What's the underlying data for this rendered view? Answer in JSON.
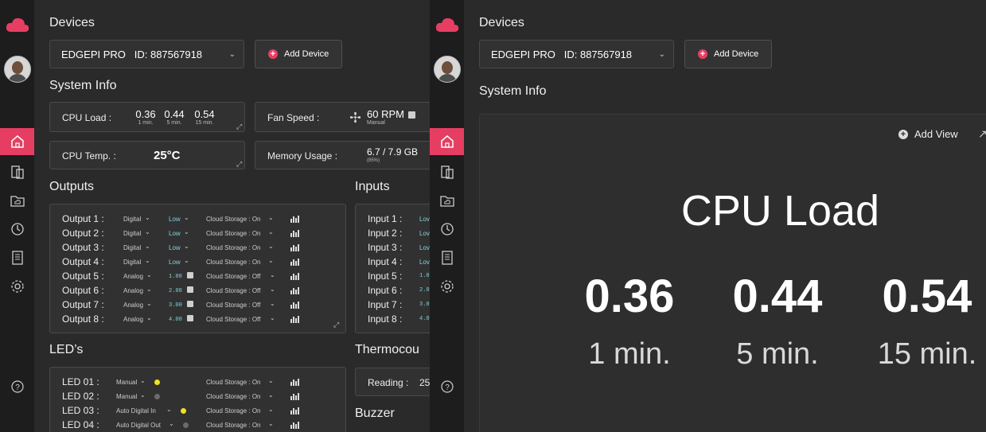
{
  "left": {
    "devices_title": "Devices",
    "device_select": "EDGEPI PRO   ID: 887567918",
    "add_device": "Add Device",
    "system_info_title": "System Info",
    "cpu_load": {
      "label": "CPU Load :",
      "values": [
        "0.36",
        "0.44",
        "0.54"
      ],
      "periods": [
        "1 min.",
        "5 min.",
        "15 min."
      ]
    },
    "fan_speed": {
      "label": "Fan Speed :",
      "value": "60 RPM",
      "mode": "Manual"
    },
    "cpu_temp": {
      "label": "CPU Temp. :",
      "value": "25°C"
    },
    "memory": {
      "label": "Memory Usage :",
      "value": "6.7 / 7.9 GB",
      "pct": "(85%)"
    },
    "outputs_title": "Outputs",
    "outputs": [
      {
        "name": "Output 1 :",
        "type": "Digital",
        "value": "Low",
        "storage": "Cloud Storage : On"
      },
      {
        "name": "Output 2 :",
        "type": "Digital",
        "value": "Low",
        "storage": "Cloud Storage : On"
      },
      {
        "name": "Output 3 :",
        "type": "Digital",
        "value": "Low",
        "storage": "Cloud Storage : On"
      },
      {
        "name": "Output 4 :",
        "type": "Digital",
        "value": "Low",
        "storage": "Cloud Storage : On"
      },
      {
        "name": "Output 5 :",
        "type": "Analog",
        "value": "1.00",
        "storage": "Cloud Storage : Off"
      },
      {
        "name": "Output 6 :",
        "type": "Analog",
        "value": "2.00",
        "storage": "Cloud Storage : Off"
      },
      {
        "name": "Output 7 :",
        "type": "Analog",
        "value": "3.00",
        "storage": "Cloud Storage : Off"
      },
      {
        "name": "Output 8 :",
        "type": "Analog",
        "value": "4.00",
        "storage": "Cloud Storage : Off"
      }
    ],
    "inputs_title": "Inputs",
    "inputs": [
      {
        "name": "Input 1 :",
        "value": "Lov"
      },
      {
        "name": "Input 2 :",
        "value": "Lov"
      },
      {
        "name": "Input 3 :",
        "value": "Lov"
      },
      {
        "name": "Input 4 :",
        "value": "Lov"
      },
      {
        "name": "Input 5 :",
        "value": "1.0"
      },
      {
        "name": "Input 6 :",
        "value": "2.0"
      },
      {
        "name": "Input 7 :",
        "value": "3.0"
      },
      {
        "name": "Input 8 :",
        "value": "4.0"
      }
    ],
    "leds_title": "LED’s",
    "leds": [
      {
        "name": "LED 01 :",
        "mode": "Manual",
        "storage": "Cloud Storage : On",
        "dot": "#f2e21f"
      },
      {
        "name": "LED 02 :",
        "mode": "Manual",
        "storage": "Cloud Storage : On",
        "dot": "#6b6b6b"
      },
      {
        "name": "LED 03 :",
        "mode": "Auto Digital In",
        "storage": "Cloud Storage : On",
        "dot": "#f2e21f"
      },
      {
        "name": "LED 04 :",
        "mode": "Auto Digital Out",
        "storage": "Cloud Storage : On",
        "dot": "#6b6b6b"
      }
    ],
    "thermo_title": "Thermocou",
    "reading_label": "Reading :",
    "reading_value": "25",
    "buzzer_title": "Buzzer"
  },
  "right": {
    "devices_title": "Devices",
    "device_select": "EDGEPI PRO   ID: 887567918",
    "add_device": "Add Device",
    "system_info_title": "System Info",
    "add_view": "Add View",
    "cpu_title": "CPU Load",
    "values": [
      "0.36",
      "0.44",
      "0.54"
    ],
    "periods": [
      "1 min.",
      "5 min.",
      "15 min."
    ]
  },
  "colors": {
    "accent": "#e63e63",
    "bg": "#2a2a2b",
    "sidebar": "#1d1d1e",
    "teal": "#7fd4d8"
  }
}
